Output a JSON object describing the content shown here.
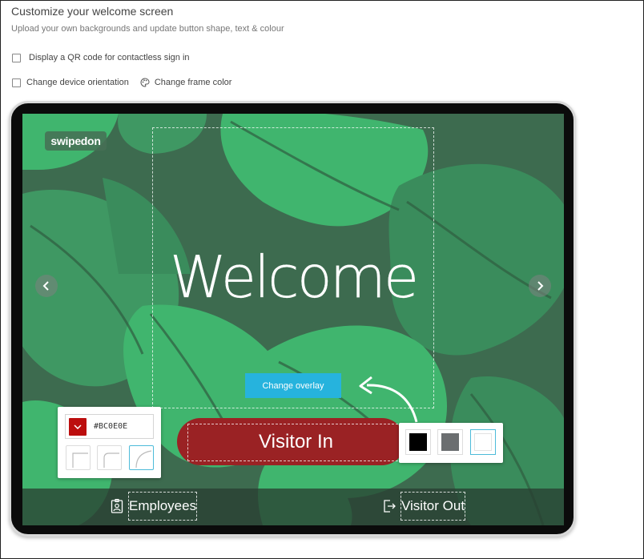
{
  "header": {
    "title": "Customize your welcome screen",
    "subtitle": "Upload your own backgrounds and update button shape, text & colour"
  },
  "options": {
    "qr_label": "Display a QR code for contactless sign in",
    "orientation_label": "Change device orientation",
    "frame_color_label": "Change frame color"
  },
  "screen": {
    "logo": "swipedon",
    "welcome": "Welcome",
    "overlay_button": "Change overlay",
    "visitor_in": "Visitor In",
    "employees": "Employees",
    "visitor_out": "Visitor Out"
  },
  "color_picker": {
    "hex": "#BC0E0E",
    "selected_color": "#bc0e0e",
    "shapes": [
      "square",
      "rounded",
      "round"
    ],
    "selected_shape": "round"
  },
  "overlay_picker": {
    "colors": [
      "#000000",
      "#6b6e70",
      "#ffffff"
    ],
    "selected": "#ffffff"
  },
  "colors": {
    "accent": "#26b3dd",
    "button": "#9a2224",
    "background": "#3d6b4f",
    "leaf": "#40b56e"
  }
}
